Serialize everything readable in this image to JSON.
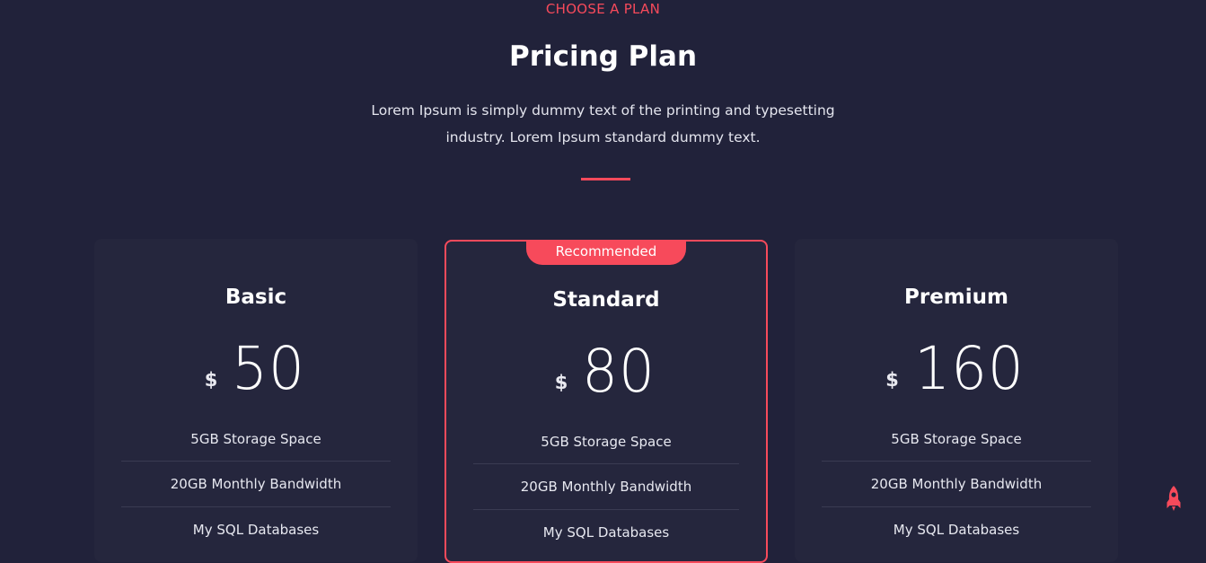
{
  "header": {
    "eyebrow": "CHOOSE A PLAN",
    "title": "Pricing Plan",
    "intro": "Lorem Ipsum is simply dummy text of the printing and typesetting industry. Lorem Ipsum standard dummy text."
  },
  "accent_color": "#f74a5b",
  "background_color": "#21223a",
  "plans": [
    {
      "name": "Basic",
      "currency": "$",
      "amount": "50",
      "recommended": false,
      "features": [
        "5GB Storage Space",
        "20GB Monthly Bandwidth",
        "My SQL Databases"
      ]
    },
    {
      "name": "Standard",
      "currency": "$",
      "amount": "80",
      "recommended": true,
      "badge": "Recommended",
      "features": [
        "5GB Storage Space",
        "20GB Monthly Bandwidth",
        "My SQL Databases"
      ]
    },
    {
      "name": "Premium",
      "currency": "$",
      "amount": "160",
      "recommended": false,
      "features": [
        "5GB Storage Space",
        "20GB Monthly Bandwidth",
        "My SQL Databases"
      ]
    }
  ],
  "floating_button": {
    "icon": "rocket-icon"
  }
}
